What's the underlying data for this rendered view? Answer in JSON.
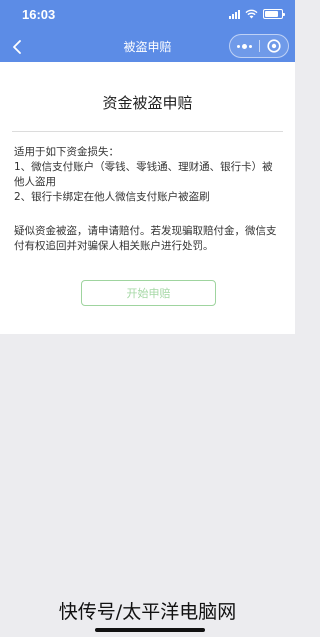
{
  "status_bar": {
    "time": "16:03",
    "battery_level": 0.8
  },
  "nav": {
    "title": "被盗申赔",
    "back_icon": "chevron-left-icon",
    "more_icon": "more-dots-icon",
    "close_icon": "target-close-icon",
    "bar_color": "#5c8ce6"
  },
  "main": {
    "heading": "资金被盗申赔",
    "intro_title": "适用于如下资金损失：",
    "intro_item_1": "1、微信支付账户（零钱、零钱通、理财通、银行卡）被他人盗用",
    "intro_item_2": "2、银行卡绑定在他人微信支付账户被盗刷",
    "notice": "疑似资金被盗，请申请赔付。若发现骗取赔付金，微信支付有权追回并对骗保人相关账户进行处罚。",
    "start_button_label": "开始申赔",
    "button_color": "#9fd49f"
  },
  "watermark": "快传号/太平洋电脑网"
}
